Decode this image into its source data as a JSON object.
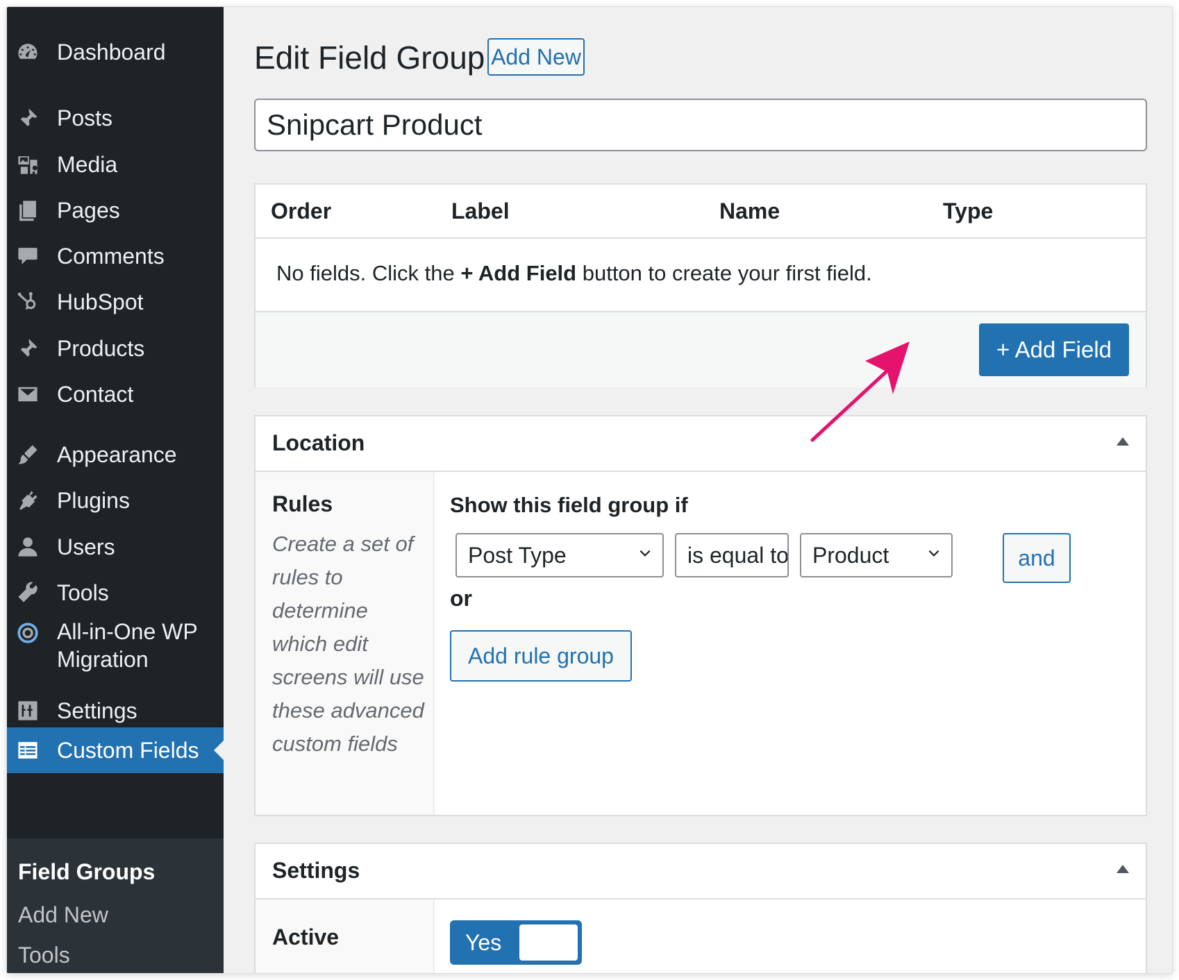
{
  "sidebar": {
    "items": [
      {
        "label": "Dashboard",
        "icon": "dashboard-icon"
      },
      {
        "label": "Posts",
        "icon": "pushpin-icon"
      },
      {
        "label": "Media",
        "icon": "media-icon"
      },
      {
        "label": "Pages",
        "icon": "pages-icon"
      },
      {
        "label": "Comments",
        "icon": "comment-icon"
      },
      {
        "label": "HubSpot",
        "icon": "hubspot-icon"
      },
      {
        "label": "Products",
        "icon": "pushpin-icon"
      },
      {
        "label": "Contact",
        "icon": "envelope-icon"
      },
      {
        "label": "Appearance",
        "icon": "paintbrush-icon"
      },
      {
        "label": "Plugins",
        "icon": "plug-icon"
      },
      {
        "label": "Users",
        "icon": "user-icon"
      },
      {
        "label": "Tools",
        "icon": "wrench-icon"
      },
      {
        "label": "All-in-One WP",
        "label2": "Migration",
        "icon": "migration-icon"
      },
      {
        "label": "Settings",
        "icon": "settings-sliders-icon"
      },
      {
        "label": "Custom Fields",
        "icon": "table-icon",
        "active": true
      }
    ],
    "submenu": [
      {
        "label": "Field Groups",
        "current": true
      },
      {
        "label": "Add New"
      },
      {
        "label": "Tools"
      }
    ]
  },
  "header": {
    "title": "Edit Field Group",
    "add_new_label": "Add New"
  },
  "title_field": {
    "value": "Snipcart Product"
  },
  "fields_table": {
    "columns": [
      "Order",
      "Label",
      "Name",
      "Type"
    ],
    "empty_text_before": "No fields. Click the ",
    "empty_text_bold": "+ Add Field",
    "empty_text_after": " button to create your first field.",
    "add_field_label": "+ Add Field"
  },
  "location": {
    "title": "Location",
    "rules_title": "Rules",
    "rules_description": "Create a set of rules to determine which edit screens will use these advanced custom fields",
    "show_if_label": "Show this field group if",
    "param_value": "Post Type",
    "operator_value": "is equal to",
    "value_value": "Product",
    "and_label": "and",
    "or_label": "or",
    "add_rule_group_label": "Add rule group"
  },
  "settings": {
    "title": "Settings",
    "active_label": "Active",
    "active_toggle_label": "Yes",
    "active_value": true
  },
  "colors": {
    "sidebar_bg": "#1d2327",
    "accent": "#2271b1",
    "annotation_arrow": "#e6136e"
  }
}
